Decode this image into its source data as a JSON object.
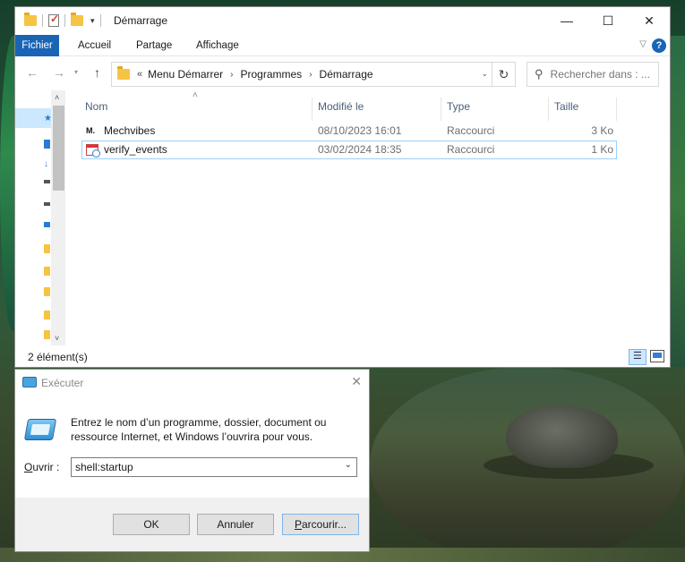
{
  "explorer": {
    "title": "Démarrage",
    "window_controls": {
      "minimize": "—",
      "maximize": "☐",
      "close": "✕"
    },
    "ribbon": {
      "tabs": [
        "Fichier",
        "Accueil",
        "Partage",
        "Affichage"
      ],
      "help": "?"
    },
    "address": {
      "overflow": "«",
      "crumbs": [
        "Menu Démarrer",
        "Programmes",
        "Démarrage"
      ]
    },
    "search": {
      "placeholder": "Rechercher dans : ..."
    },
    "columns": {
      "name": "Nom",
      "modified": "Modifié le",
      "type": "Type",
      "size": "Taille"
    },
    "files": [
      {
        "name": "Mechvibes",
        "modified": "08/10/2023 16:01",
        "type": "Raccourci",
        "size": "3 Ko",
        "icon": "mechvibes-icon",
        "icon_text": "M."
      },
      {
        "name": "verify_events",
        "modified": "03/02/2024 18:35",
        "type": "Raccourci",
        "size": "1 Ko",
        "icon": "calendar-shortcut-icon"
      }
    ],
    "status": "2 élément(s)"
  },
  "run_dialog": {
    "title": "Exécuter",
    "description": "Entrez le nom d’un programme, dossier, document ou ressource Internet, et Windows l’ouvrira pour vous.",
    "open_label": "Ouvrir :",
    "open_value": "shell:startup",
    "buttons": {
      "ok": "OK",
      "cancel": "Annuler",
      "browse": "Parcourir..."
    }
  }
}
